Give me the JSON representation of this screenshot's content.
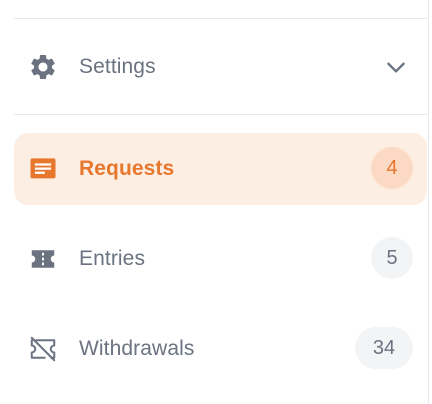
{
  "colors": {
    "accent": "#e8772e",
    "accent_bg": "#fdeee4",
    "accent_badge_bg": "#fbd9c3",
    "muted_text": "#6b7280",
    "badge_bg": "#f3f4f6",
    "divider": "#e5e7eb"
  },
  "settings": {
    "label": "Settings",
    "icon": "gear-icon",
    "expand_icon": "chevron-down-icon",
    "expanded": false
  },
  "nav": {
    "items": [
      {
        "label": "Requests",
        "icon": "message-icon",
        "count": "4",
        "active": true
      },
      {
        "label": "Entries",
        "icon": "ticket-icon",
        "count": "5",
        "active": false
      },
      {
        "label": "Withdrawals",
        "icon": "ticket-off-icon",
        "count": "34",
        "active": false
      }
    ]
  }
}
